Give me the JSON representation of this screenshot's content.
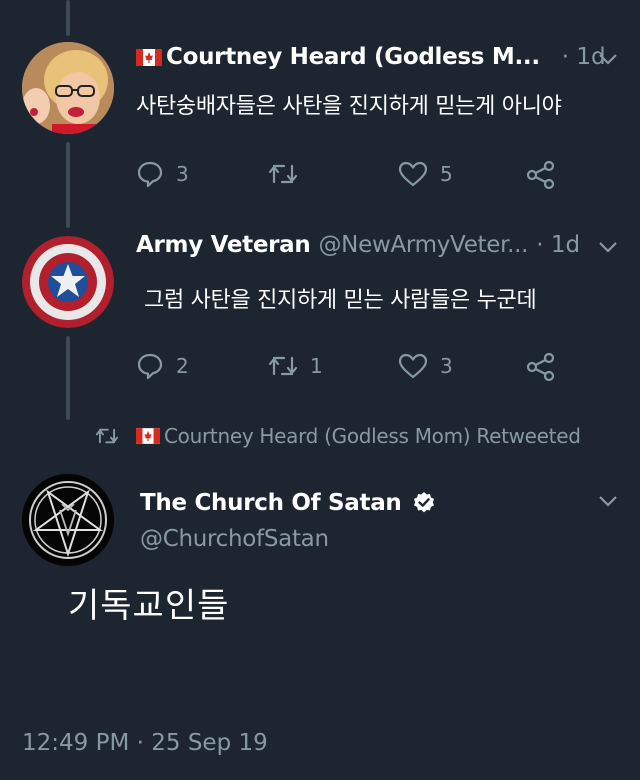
{
  "tweets": [
    {
      "display_name": "Courtney Heard (Godless M...",
      "handle": "",
      "time": "· 1d",
      "text": "사탄숭배자들은 사탄을 진지하게 믿는게 아니야",
      "replies": "3",
      "retweets": "",
      "likes": "5",
      "flag_color": "#d52b1e"
    },
    {
      "display_name": "Army Veteran",
      "handle": "@NewArmyVeter...",
      "time": "· 1d",
      "text": "그럼 사탄을 진지하게 믿는 사람들은 누군데",
      "replies": "2",
      "retweets": "1",
      "likes": "3"
    }
  ],
  "retweet_note": "Courtney Heard (Godless Mom) Retweeted",
  "main_tweet": {
    "display_name": "The Church Of Satan",
    "handle": "@ChurchofSatan",
    "verified": true,
    "text": "기독교인들",
    "timestamp": "12:49 PM · 25 Sep 19"
  },
  "colors": {
    "background": "#1c2530",
    "secondary_text": "#8899a6",
    "thread_line": "#3d4955"
  },
  "icons": [
    "reply-icon",
    "retweet-icon",
    "like-icon",
    "share-icon",
    "chevron-down-icon",
    "verified-icon",
    "canada-flag-icon"
  ]
}
